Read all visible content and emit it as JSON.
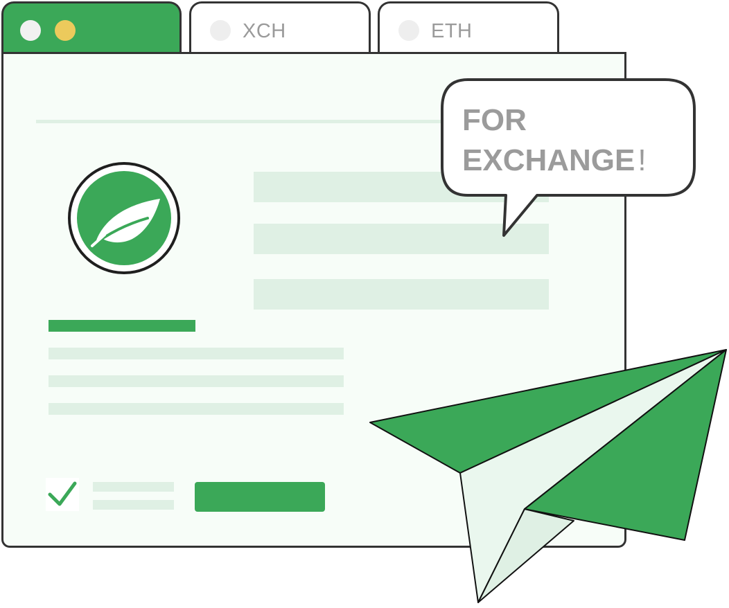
{
  "tabs": {
    "active": {
      "dots": [
        "close-dot",
        "minimize-dot"
      ]
    },
    "items": [
      {
        "label": "XCH"
      },
      {
        "label": "ETH"
      }
    ]
  },
  "bubble": {
    "line1": "FOR",
    "line2": "EXCHANGE",
    "punct": "!"
  },
  "icons": {
    "logo": "leaf-icon",
    "check": "checkmark-icon",
    "plane": "paper-plane-icon"
  },
  "colors": {
    "brand_green": "#3ba858",
    "light_green": "#dff0e4",
    "window_bg": "#f7fdf8",
    "outline": "#333333",
    "yellow_dot": "#ecca5c",
    "gray_text": "#9b9b9b"
  }
}
